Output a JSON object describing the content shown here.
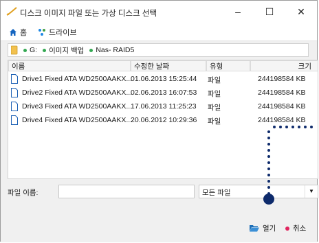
{
  "window": {
    "title": "디스크 이미지 파일 또는 가상 디스크 선택",
    "minimize": "–",
    "maximize": "☐",
    "close": "✕"
  },
  "nav": {
    "home": "홈",
    "drives": "드라이브"
  },
  "path": {
    "segments": [
      "G:",
      "이미지 백업",
      "Nas- RAID5"
    ]
  },
  "columns": {
    "name": "이름",
    "modified": "수정한 날짜",
    "type": "유형",
    "size": "크기",
    "sort_indicator": "^"
  },
  "files": [
    {
      "name": "Drive1 Fixed ATA WD2500AAKX...",
      "modified": "01.06.2013 15:25:44",
      "type": "파일",
      "size": "244198584 KB"
    },
    {
      "name": "Drive2 Fixed ATA WD2500AAKX...",
      "modified": "02.06.2013 16:07:53",
      "type": "파일",
      "size": "244198584 KB"
    },
    {
      "name": "Drive3 Fixed ATA WD2500AAKX...",
      "modified": "17.06.2013 11:25:23",
      "type": "파일",
      "size": "244198584 KB"
    },
    {
      "name": "Drive4 Fixed ATA WD2500AAKX...",
      "modified": "20.06.2012 10:29:36",
      "type": "파일",
      "size": "244198584 KB"
    }
  ],
  "footer": {
    "filename_label": "파일 이름:",
    "filename_value": "",
    "filter_value": "모든 파일",
    "open_label": "열기",
    "cancel_label": "취소"
  },
  "colors": {
    "accent_dot": "#34a853",
    "hint_dots": "#0d2a6b",
    "cancel_dot": "#e0245e",
    "folder": "#f2c14e",
    "home_icon": "#1565c0"
  }
}
